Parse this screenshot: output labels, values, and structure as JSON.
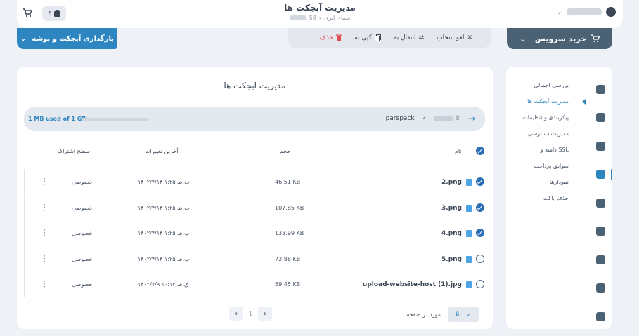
{
  "header": {
    "title": "مدیریت آبجکت ها",
    "breadcrumb_parent": "فضای ابری",
    "breadcrumb_sep": "›",
    "breadcrumb_suffix": "58",
    "notification_count": "۴"
  },
  "toolbar": {
    "upload_label": "بارگذاری آبجکت و پوشه",
    "deselect_label": "لغو انتخاب",
    "move_label": "انتقال به",
    "copy_label": "کپی به",
    "delete_label": "حذف",
    "buy_label": "خرید سرویس"
  },
  "main": {
    "title": "مدیریت آبجکت ها",
    "usage_text": "1 MB used of 1 GB",
    "usage_fraction": 0.001,
    "bucket": "parspack",
    "path_suffix": "8",
    "columns": {
      "name": "نام",
      "size": "حجم",
      "modified": "آخرین تغییرات",
      "access": "سطح اشتراک"
    },
    "rows": [
      {
        "name": "2.png",
        "size": "46.51 KB",
        "modified": "۱۴۰۲/۴/۱۴ ۱:۲۵ ب.ظ",
        "access": "خصوصی",
        "checked": true
      },
      {
        "name": "3.png",
        "size": "107.85 KB",
        "modified": "۱۴۰۲/۴/۱۴ ۱:۲۵ ب.ظ",
        "access": "خصوصی",
        "checked": true
      },
      {
        "name": "4.png",
        "size": "133.99 KB",
        "modified": "۱۴۰۲/۴/۱۴ ۱:۲۵ ب.ظ",
        "access": "خصوصی",
        "checked": true
      },
      {
        "name": "5.png",
        "size": "72.88 KB",
        "modified": "۱۴۰۲/۴/۱۴ ۱:۲۵ ب.ظ",
        "access": "خصوصی",
        "checked": false
      },
      {
        "name": "upload-website-host (1).jpg",
        "size": "59.45 KB",
        "modified": "۱۴۰۲/۷/۹ ۱۰:۱۲ ق.ظ",
        "access": "خصوصی",
        "checked": false
      }
    ],
    "pagination": {
      "current_page": "1",
      "per_page_label": "مورد در صفحه",
      "per_page_value": "۵۰"
    }
  },
  "sidebar": {
    "items": [
      {
        "label": "بررسی اجمالی"
      },
      {
        "label": "مدیریت آبجکت ها",
        "active": true
      },
      {
        "label": "پیکربندی و تنظیمات"
      },
      {
        "label": "مدیریت دسترسی"
      },
      {
        "label": "دامنه و SSL"
      },
      {
        "label": "سوابق پرداخت"
      },
      {
        "label": "نمودارها"
      },
      {
        "label": "حذف باکت"
      }
    ],
    "icons": [
      "dashboard-icon",
      "card-icon",
      "server-icon",
      "storage-icon",
      "shield-icon",
      "cloud-icon",
      "document-icon",
      "headset-icon",
      "user-icon"
    ]
  },
  "colors": {
    "accent": "#2e86c1",
    "buy": "#4a6274",
    "danger": "#e24c4c"
  }
}
